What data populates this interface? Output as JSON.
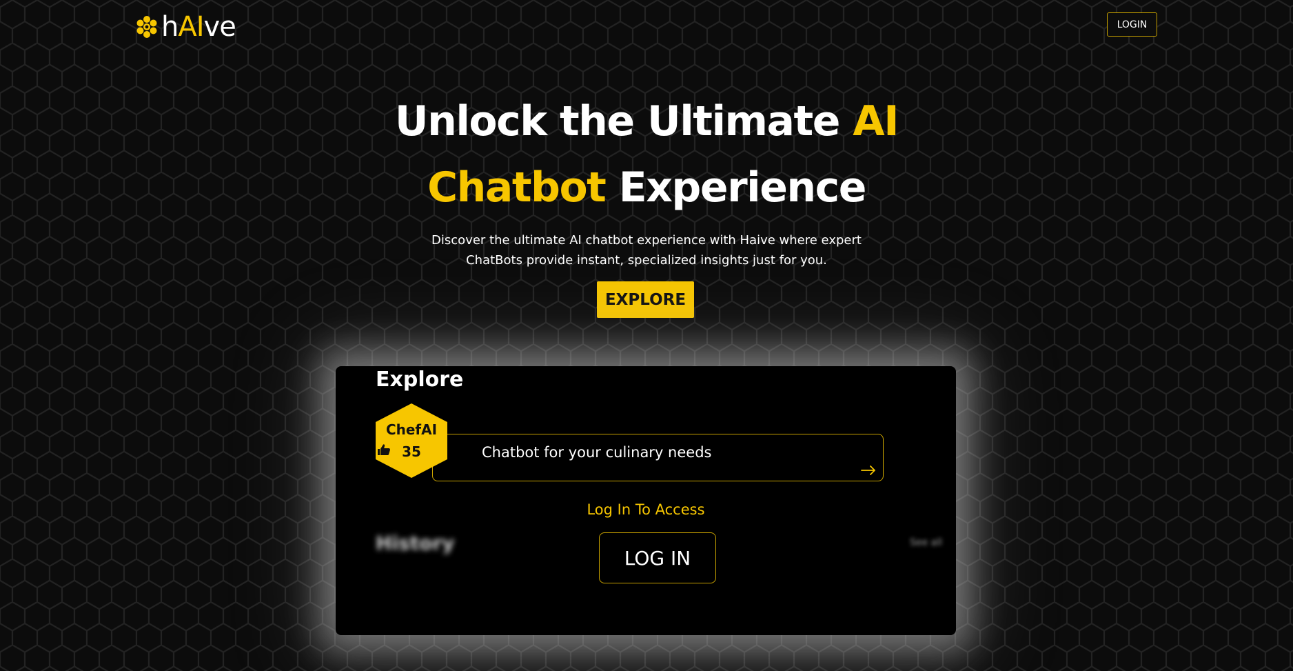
{
  "header": {
    "logo_prefix": "h",
    "logo_highlight": "AI",
    "logo_suffix": "ve",
    "login_label": "LOGIN"
  },
  "hero": {
    "title_part1": "Unlock the Ultimate ",
    "title_highlight1": "AI",
    "title_highlight2": "Chatbot",
    "title_part2": " Experience",
    "subtitle_line1": "Discover the ultimate AI chatbot experience with Haive where expert",
    "subtitle_line2": "ChatBots provide instant, specialized insights just for you.",
    "explore_label": "EXPLORE"
  },
  "panel": {
    "title": "Explore",
    "bot": {
      "name": "ChefAI",
      "likes": "35",
      "description": "Chatbot for your culinary needs"
    },
    "access_text": "Log In To Access",
    "history_label": "History",
    "see_all_label": "See all",
    "login_label": "LOG IN"
  },
  "colors": {
    "accent": "#f7c600",
    "background": "#0c0c0c",
    "panel": "#000000"
  },
  "icons": {
    "logo": "honeycomb-flower-icon",
    "card_arrow": "arrow-right-icon",
    "likes": "thumbs-up-icon"
  }
}
